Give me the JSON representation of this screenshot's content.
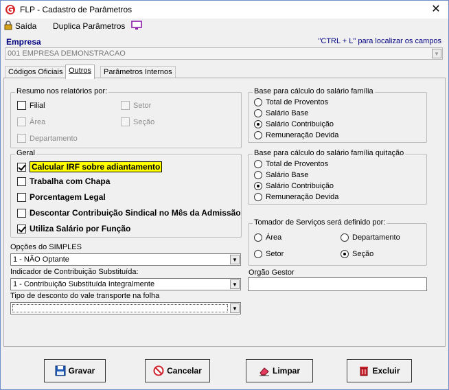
{
  "window": {
    "title": "FLP - Cadastro de Parâmetros",
    "close_glyph": "✕"
  },
  "menu": {
    "saida_label": "Saída",
    "duplica_label": "Duplica Parâmetros"
  },
  "empresa": {
    "label": "Empresa",
    "hint": "\"CTRL + L\" para localizar os campos",
    "value": "001 EMPRESA DEMONSTRACAO"
  },
  "tabs": [
    {
      "label": "Códigos Oficiais",
      "active": false
    },
    {
      "label": "Outros",
      "active": true
    },
    {
      "label": "Parâmetros Internos",
      "active": false
    }
  ],
  "resumo": {
    "legend": "Resumo nos relatórios por:",
    "items": [
      {
        "label": "Filial",
        "checked": false,
        "enabled": true
      },
      {
        "label": "Setor",
        "checked": false,
        "enabled": false
      },
      {
        "label": "Área",
        "checked": false,
        "enabled": false
      },
      {
        "label": "Seção",
        "checked": false,
        "enabled": false
      },
      {
        "label": "Departamento",
        "checked": false,
        "enabled": false
      }
    ]
  },
  "geral": {
    "legend": "Geral",
    "items": [
      {
        "label": "Calcular IRF sobre adiantamento",
        "checked": true,
        "highlighted": true
      },
      {
        "label": "Trabalha com Chapa",
        "checked": false
      },
      {
        "label": "Porcentagem Legal",
        "checked": false
      },
      {
        "label": "Descontar Contribuição Sindical no Mês da  Admissão",
        "checked": false
      },
      {
        "label": "Utiliza Salário por Função",
        "checked": true
      }
    ]
  },
  "salario_familia": {
    "legend": "Base para cálculo do salário família",
    "options": [
      "Total de Proventos",
      "Salário Base",
      "Salário Contribuição",
      "Remuneração Devida"
    ],
    "selected": 2
  },
  "salario_familia_quitacao": {
    "legend": "Base para cálculo do salário família quitação",
    "options": [
      "Total de Proventos",
      "Salário Base",
      "Salário Contribuição",
      "Remuneração Devida"
    ],
    "selected": 2
  },
  "tomador": {
    "legend": "Tomador de Serviços será definido por:",
    "options": [
      "Área",
      "Departamento",
      "Setor",
      "Seção"
    ],
    "selected": 3
  },
  "simples": {
    "label": "Opções do SIMPLES",
    "value": "1 - NÃO Optante"
  },
  "contribuicao": {
    "label": "Indicador de Contribuição Substituída:",
    "value": "1 - Contribuição Substituída Integralmente"
  },
  "vale_transporte": {
    "label": "Tipo de desconto do vale transporte na folha",
    "value": ""
  },
  "orgao_gestor": {
    "label": "Orgão Gestor",
    "value": ""
  },
  "buttons": {
    "gravar": "Gravar",
    "cancelar": "Cancelar",
    "limpar": "Limpar",
    "excluir": "Excluir"
  },
  "icons": {
    "app": "flp-logo-icon",
    "lock": "lock-icon",
    "monitor": "monitor-icon",
    "save": "floppy-disk-icon",
    "cancel": "no-entry-icon",
    "eraser": "eraser-icon",
    "trash": "trash-icon"
  },
  "colors": {
    "accent_label": "#000080",
    "highlight": "#ffff00",
    "app_logo": "#d7262b"
  }
}
